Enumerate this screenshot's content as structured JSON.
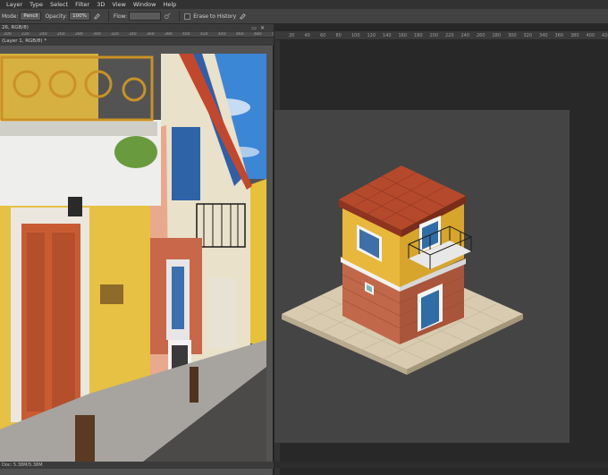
{
  "menubar": {
    "items": [
      "Layer",
      "Type",
      "Select",
      "Filter",
      "3D",
      "View",
      "Window",
      "Help"
    ]
  },
  "options": {
    "mode_label": "Mode:",
    "mode_value": "Pencil",
    "opacity_label": "Opacity:",
    "opacity_value": "100%",
    "flow_label": "Flow:",
    "erase_history_label": "Erase to History"
  },
  "document": {
    "tab_title": "26, RGB/8)",
    "tab_title_inner": "(Layer 1, RGB/8) *",
    "status": "Doc: 5.38M/5.38M",
    "ruler_ticks": [
      "200",
      "220",
      "240",
      "260",
      "280",
      "300",
      "320",
      "340",
      "360",
      "380",
      "400",
      "420",
      "440",
      "460",
      "480",
      "500",
      "520",
      "540",
      "560",
      "580"
    ]
  },
  "workspace": {
    "ruler_ticks": [
      "20",
      "40",
      "60",
      "80",
      "100",
      "120",
      "140",
      "160",
      "180",
      "200",
      "220",
      "240",
      "260",
      "280",
      "300",
      "320",
      "340",
      "360",
      "380",
      "400",
      "420"
    ]
  },
  "colors": {
    "canvas": "#444444",
    "tile": "#d8cbb0",
    "roof": "#b5492c",
    "wall_yellow": "#e8b83c",
    "brick": "#c2684a",
    "door_blue": "#2f6da6",
    "window_blue": "#3e6fa9"
  }
}
